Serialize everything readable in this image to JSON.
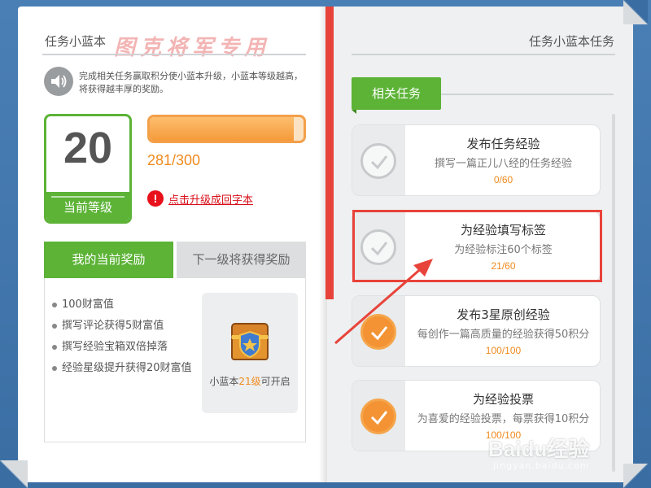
{
  "left": {
    "title": "任务小蓝本",
    "watermark": "图克将军专用",
    "intro": "完成相关任务赢取积分使小蓝本升级，小蓝本等级越高，将获得越丰厚的奖励。",
    "level": {
      "value": "20",
      "label": "当前等级"
    },
    "progress": {
      "text": "281/300",
      "fraction": 0.937
    },
    "upgrade_link": "点击升级成回字本",
    "tabs": {
      "active": "我的当前奖励",
      "inactive": "下一级将获得奖励"
    },
    "rewards": [
      "100财富值",
      "撰写评论获得5财富值",
      "撰写经验宝箱双倍掉落",
      "经验星级提升获得20财富值"
    ],
    "chest": {
      "prefix": "小蓝本",
      "level": "21级",
      "suffix": "可开启"
    }
  },
  "right": {
    "title": "任务小蓝本任务",
    "section": "相关任务",
    "tasks": [
      {
        "title": "发布任务经验",
        "desc": "撰写一篇正儿八经的任务经验",
        "progress": "0/60",
        "done": false
      },
      {
        "title": "为经验填写标签",
        "desc": "为经验标注60个标签",
        "progress": "21/60",
        "done": false
      },
      {
        "title": "发布3星原创经验",
        "desc": "每创作一篇高质量的经验获得50积分",
        "progress": "100/100",
        "done": true
      },
      {
        "title": "为经验投票",
        "desc": "为喜爱的经验投票，每票获得10积分",
        "progress": "100/100",
        "done": true
      }
    ]
  },
  "footer": {
    "brand": "Baidu经验",
    "url": "jingyan.baidu.com"
  },
  "colors": {
    "green": "#5cb336",
    "orange": "#f08a1e",
    "red": "#e8433a",
    "frame": "#3a6ea3"
  },
  "icons": [
    "speaker-icon",
    "warning-icon",
    "treasure-chest-icon",
    "checkmark-icon",
    "arrow-annotation"
  ]
}
